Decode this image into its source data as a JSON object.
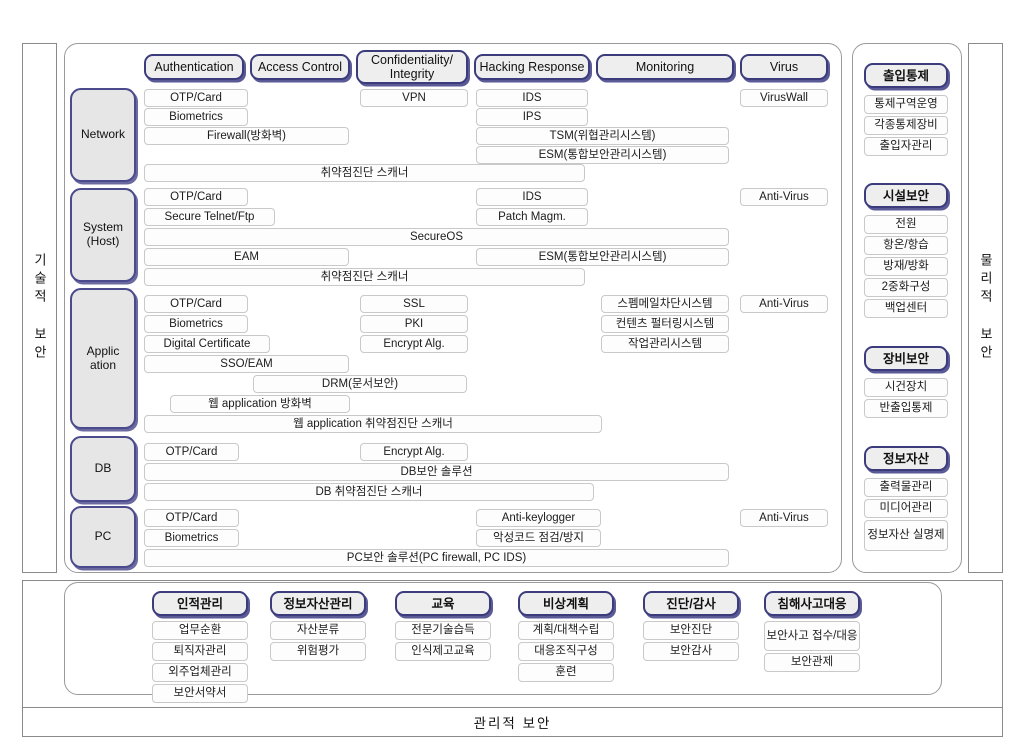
{
  "diagram": {
    "left_axis_label": "기술적 보안",
    "right_axis_label": "물리적 보안",
    "bottom_title": "관리적 보안"
  },
  "technical": {
    "columns": [
      {
        "label": "Authentication"
      },
      {
        "label": "Access Control"
      },
      {
        "label": "Confidentiality/ Integrity"
      },
      {
        "label": "Hacking Response"
      },
      {
        "label": "Monitoring"
      },
      {
        "label": "Virus"
      }
    ],
    "rows": [
      {
        "label": "Network",
        "items": [
          {
            "text": "OTP/Card"
          },
          {
            "text": "Biometrics"
          },
          {
            "text": "Firewall(방화벽)"
          },
          {
            "text": "취약점진단 스캐너"
          },
          {
            "text": "VPN"
          },
          {
            "text": "IDS"
          },
          {
            "text": "IPS"
          },
          {
            "text": "TSM(위협관리시스템)"
          },
          {
            "text": "ESM(통합보안관리시스템)"
          },
          {
            "text": "VirusWall"
          }
        ]
      },
      {
        "label": "System (Host)",
        "items": [
          {
            "text": "OTP/Card"
          },
          {
            "text": "Secure Telnet/Ftp"
          },
          {
            "text": "SecureOS"
          },
          {
            "text": "EAM"
          },
          {
            "text": "취약점진단 스캐너"
          },
          {
            "text": "IDS"
          },
          {
            "text": "Patch Magm."
          },
          {
            "text": "ESM(통합보안관리시스템)"
          },
          {
            "text": "Anti-Virus"
          }
        ]
      },
      {
        "label": "Applic ation",
        "items": [
          {
            "text": "OTP/Card"
          },
          {
            "text": "Biometrics"
          },
          {
            "text": "Digital Certificate"
          },
          {
            "text": "SSO/EAM"
          },
          {
            "text": "DRM(문서보안)"
          },
          {
            "text": "웹 application 방화벽"
          },
          {
            "text": "웹 application 취약점진단 스캐너"
          },
          {
            "text": "SSL"
          },
          {
            "text": "PKI"
          },
          {
            "text": "Encrypt Alg."
          },
          {
            "text": "스펨메일차단시스템"
          },
          {
            "text": "컨텐츠 펄터링시스템"
          },
          {
            "text": "작업관리시스템"
          },
          {
            "text": "Anti-Virus"
          }
        ]
      },
      {
        "label": "DB",
        "items": [
          {
            "text": "OTP/Card"
          },
          {
            "text": "Encrypt Alg."
          },
          {
            "text": "DB보안 솔루션"
          },
          {
            "text": "DB 취약점진단 스캐너"
          }
        ]
      },
      {
        "label": "PC",
        "items": [
          {
            "text": "OTP/Card"
          },
          {
            "text": "Biometrics"
          },
          {
            "text": "Anti-keylogger"
          },
          {
            "text": "악성코드 점검/방지"
          },
          {
            "text": "PC보안 솔루션(PC firewall, PC IDS)"
          },
          {
            "text": "Anti-Virus"
          }
        ]
      }
    ]
  },
  "physical": {
    "groups": [
      {
        "title": "출입통제",
        "items": [
          "통제구역운영",
          "각종통제장비",
          "출입자관리"
        ]
      },
      {
        "title": "시설보안",
        "items": [
          "전원",
          "항온/항습",
          "방재/방화",
          "2중화구성",
          "백업센터"
        ]
      },
      {
        "title": "장비보안",
        "items": [
          "시건장치",
          "반출입통제"
        ]
      },
      {
        "title": "정보자산",
        "items": [
          "출력물관리",
          "미디어관리",
          "정보자산 실명제"
        ]
      }
    ]
  },
  "administrative": {
    "groups": [
      {
        "title": "인적관리",
        "items": [
          "업무순환",
          "퇴직자관리",
          "외주업체관리",
          "보안서약서"
        ]
      },
      {
        "title": "정보자산관리",
        "items": [
          "자산분류",
          "위험평가"
        ]
      },
      {
        "title": "교육",
        "items": [
          "전문기술습득",
          "인식제고교육"
        ]
      },
      {
        "title": "비상계획",
        "items": [
          "계획/대책수립",
          "대응조직구성",
          "훈련"
        ]
      },
      {
        "title": "진단/감사",
        "items": [
          "보안진단",
          "보안감사"
        ]
      },
      {
        "title": "침해사고대응",
        "items": [
          "보안사고 접수/대응",
          "보안관제"
        ]
      }
    ]
  },
  "colors": {
    "pill_border": "#3c3c7d",
    "pill_fill": "#eeeeee",
    "pill_shadow": "#5a5a96",
    "rowlabel_fill": "#e6e6e6",
    "item_border": "#c9c9c9",
    "frame_border": "#9a9a9a"
  }
}
